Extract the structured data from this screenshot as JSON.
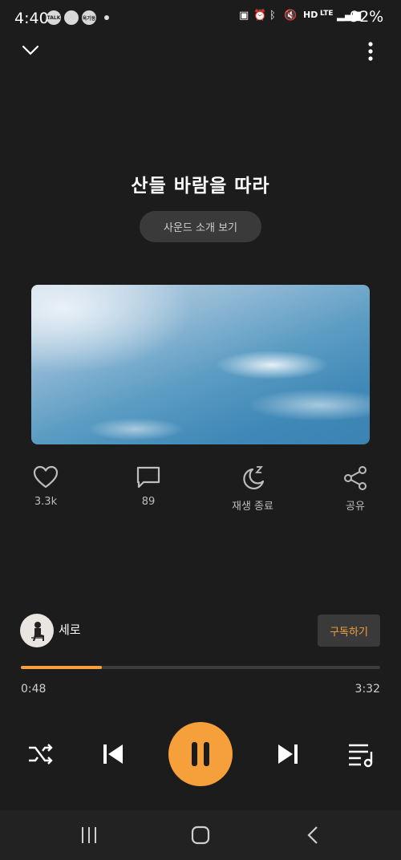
{
  "status": {
    "time": "4:40",
    "battery": "92%",
    "badges": [
      "TALK",
      "",
      "옥기동"
    ],
    "network": "LTE",
    "hd": "HD"
  },
  "song": {
    "title": "산들 바람을 따라",
    "intro_button": "사운드 소개 보기"
  },
  "actions": {
    "like": {
      "count": "3.3k",
      "icon": "heart-icon"
    },
    "comment": {
      "count": "89",
      "icon": "comment-icon"
    },
    "sleep": {
      "label": "재생 종료",
      "icon": "sleep-timer-icon"
    },
    "share": {
      "label": "공유",
      "icon": "share-icon"
    }
  },
  "artist": {
    "name": "세로",
    "subscribe_label": "구독하기"
  },
  "progress": {
    "current": "0:48",
    "total": "3:32",
    "fraction": 0.226
  },
  "colors": {
    "accent": "#f5a03a",
    "background": "#1c1c1c"
  }
}
